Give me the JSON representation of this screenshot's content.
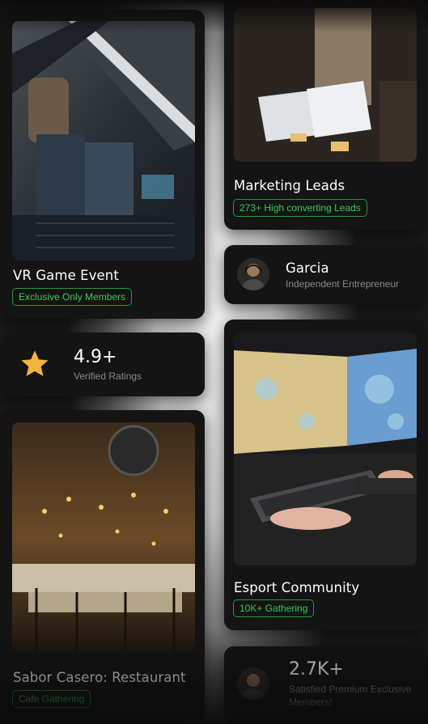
{
  "cards": {
    "vr_event": {
      "title": "VR Game Event",
      "tag": "Exclusive Only Members"
    },
    "rating": {
      "value": "4.9+",
      "label": "Verified Ratings",
      "icon": "star-icon",
      "star_color": "#f3b63c"
    },
    "restaurant": {
      "title": "Sabor Casero: Restaurant",
      "tag": "Cafe Gathering"
    },
    "marketing": {
      "title": "Marketing Leads",
      "tag": "273+ High converting Leads"
    },
    "profile": {
      "name": "Garcia",
      "role": "Independent Entrepreneur"
    },
    "esport": {
      "title": "Esport Community",
      "tag": "10K+ Gathering"
    },
    "members": {
      "value": "2.7K+",
      "label_line1": "Satisfied Premium Exclusive",
      "label_line2": "Members!"
    }
  },
  "colors": {
    "accent_green": "#36c95a",
    "card_bg": "#141414"
  }
}
